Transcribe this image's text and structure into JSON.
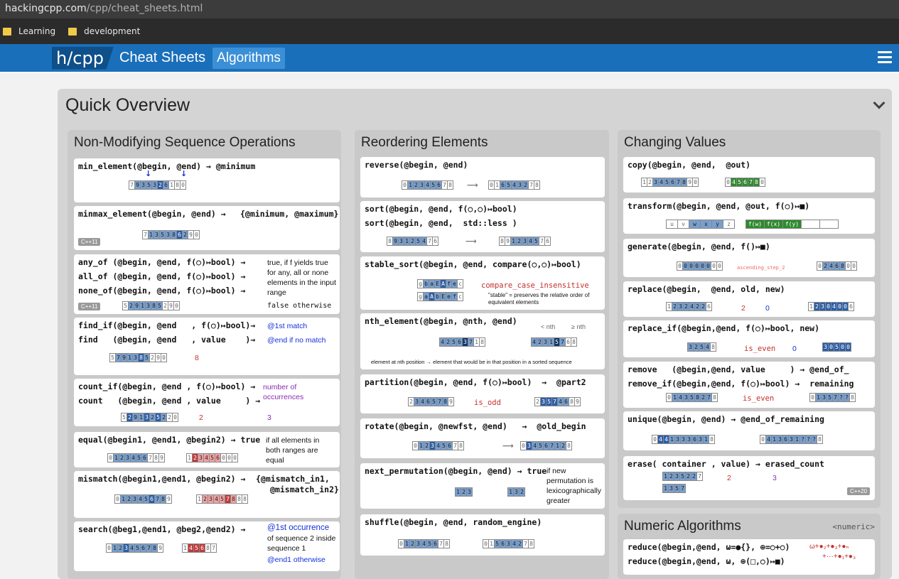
{
  "browser": {
    "domain": "hackingcpp.com",
    "path": "/cpp/cheat_sheets.html",
    "bookmarks": [
      {
        "label": "Learning"
      },
      {
        "label": "development"
      }
    ]
  },
  "nav": {
    "logo": "h/cpp",
    "title": "Cheat Sheets",
    "active_tab": "Algorithms"
  },
  "overview": {
    "title": "Quick Overview"
  },
  "col1": {
    "title": "Non-Modifying Sequence Operations",
    "min_element": {
      "line": "min_element(@begin, @end) → @minimum"
    },
    "minmax": {
      "line": "minmax_element(@begin, @end) →",
      "result": "{@minimum, @maximum}",
      "badge": "C++11"
    },
    "anyof": {
      "l1": "any_of (@begin, @end, f(○)↦bool) →",
      "l2": "all_of (@begin, @end, f(○)↦bool) →",
      "l3": "none_of(@begin, @end, f(○)↦bool) →",
      "n1": "true, if f yields true for any, all or none elements in the input range",
      "n2": "false otherwise",
      "badge": "C++11"
    },
    "findif": {
      "l1": "find_if(@begin, @end   , f(○)↦bool)→",
      "l2": "find   (@begin, @end   , value    )→",
      "n1": "@1st match",
      "n2": "@end if no match",
      "v": "8"
    },
    "countif": {
      "l1": "count_if(@begin, @end , f(○)↦bool) →",
      "l2": "count   (@begin, @end , value     ) →",
      "n": "number of occurrences",
      "v1": "2",
      "v2": "3"
    },
    "equal": {
      "line": "equal(@begin1, @end1, @begin2) → true",
      "n": "if all elements in both ranges are equal"
    },
    "mismatch": {
      "line": "mismatch(@begin1,@end1, @begin2) →",
      "r1": "{@mismatch_in1,",
      "r2": "@mismatch_in2}"
    },
    "search": {
      "line": "search(@beg1,@end1, @beg2,@end2) →",
      "n1": "@1st occurrence",
      "n2": "of sequence 2 inside sequence 1",
      "n3": "@end1 otherwise"
    }
  },
  "col2": {
    "title": "Reordering Elements",
    "reverse": {
      "line": "reverse(@begin, @end)"
    },
    "sort": {
      "l1": "sort(@begin, @end, f(○,○)↦bool)",
      "l2": "sort(@begin, @end,  std::less )"
    },
    "stable": {
      "line": "stable_sort(@begin, @end, compare(○,○)↦bool)",
      "cmp": "compare_case_insensitive",
      "n": "\"stable\" = preserves the relative order of equivalent elements"
    },
    "nth": {
      "line": "nth_element(@begin, @nth, @end)",
      "lt": "< nth",
      "ge": "≥ nth",
      "n": "element at nth position → element that would be in that position in a sorted sequence"
    },
    "partition": {
      "line": "partition(@begin, @end, f(○)↦bool)  →  @part2",
      "pred": "is_odd"
    },
    "rotate": {
      "line": "rotate(@begin, @newfst, @end)   →  @old_begin"
    },
    "nextperm": {
      "line": "next_permutation(@begin, @end) → true",
      "n": "if new permutation is lexicographically greater"
    },
    "shuffle": {
      "line": "shuffle(@begin, @end, random_engine)"
    }
  },
  "col3": {
    "title": "Changing Values",
    "copy": {
      "line": "copy(@begin, @end,  @out)"
    },
    "transform": {
      "line": "transform(@begin, @end, @out, f(○)↦■)",
      "fx": [
        "f(w)",
        "f(x)",
        "f(y)"
      ]
    },
    "generate": {
      "line": "generate(@begin, @end, f()↦■)",
      "fn": "ascending_step_2"
    },
    "replace": {
      "line": "replace(@begin,  @end, old, new)",
      "a": "2",
      "b": "0"
    },
    "replaceif": {
      "line": "replace_if(@begin,@end, f(○)↦bool, new)",
      "pred": "is_even",
      "v": "0"
    },
    "remove": {
      "l1": "remove   (@begin,@end, value     ) → @end_of_",
      "l2": "remove_if(@begin,@end, f(○)↦bool) →  remaining",
      "pred": "is_even"
    },
    "unique": {
      "line": "unique(@begin, @end) → @end_of_remaining"
    },
    "erase": {
      "line": "erase( container , value) → erased_count",
      "v": "2",
      "c": "3",
      "badge": "C++20"
    }
  },
  "col4": {
    "title": "Numeric Algorithms",
    "tag": "<numeric>",
    "l1": "reduce(@begin,@end, ω=●{}, ⊕=○+○)",
    "l2": "reduce(@begin,@end, ω, ⊕(□,○)↦■)",
    "res1": "ω+●₂+●₃+●ₙ",
    "res2": "+···+●₁+●₃"
  },
  "colors": {
    "nav": "#1a6fba",
    "blue": "#1530d8",
    "red": "#c4302b"
  }
}
